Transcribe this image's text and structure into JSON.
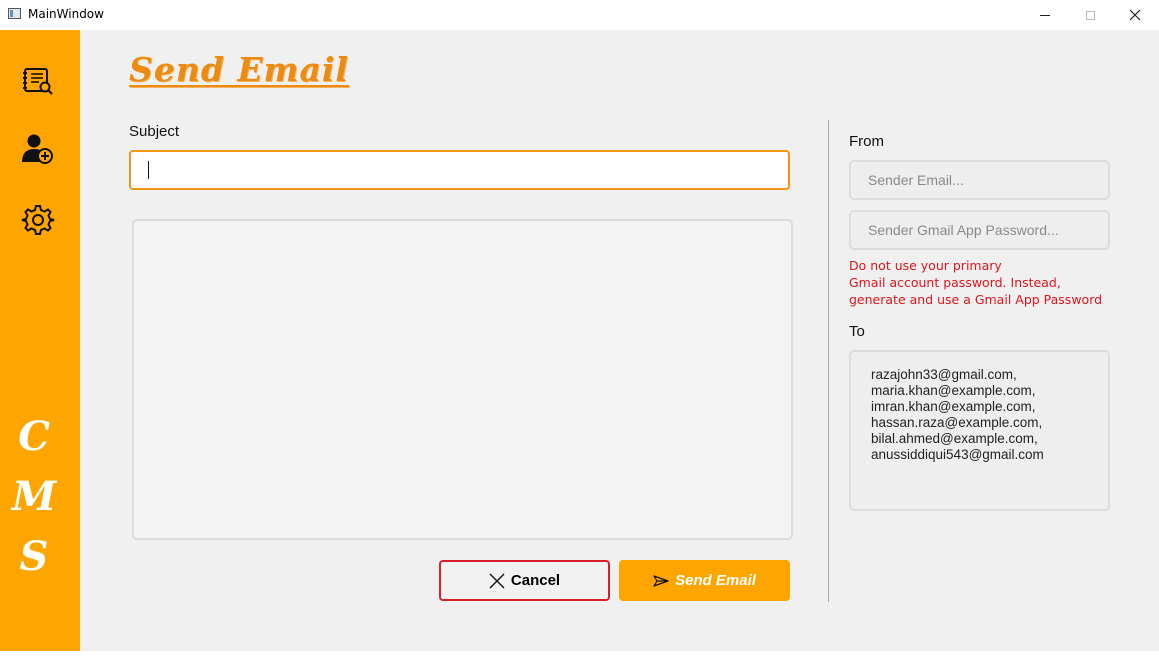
{
  "window": {
    "title": "MainWindow"
  },
  "sidebar": {
    "items": [
      {
        "icon": "address-book-icon"
      },
      {
        "icon": "add-user-icon"
      },
      {
        "icon": "gear-icon"
      }
    ],
    "brand_letters": [
      "C",
      "M",
      "S"
    ]
  },
  "page": {
    "title": "Send Email"
  },
  "form": {
    "subject_label": "Subject",
    "subject_value": "",
    "body_value": "",
    "cancel_label": "Cancel",
    "send_label": "Send Email"
  },
  "sender": {
    "from_label": "From",
    "email_placeholder": "Sender Email...",
    "password_placeholder": "Sender Gmail App Password...",
    "warning_lines": [
      "Do not use your primary",
      "Gmail account password. Instead,",
      "generate and use a Gmail App Password"
    ]
  },
  "recipients": {
    "to_label": "To",
    "list": [
      "razajohn33@gmail.com,",
      "maria.khan@example.com,",
      "imran.khan@example.com,",
      "hassan.raza@example.com,",
      "bilal.ahmed@example.com,",
      "anussiddiqui543@gmail.com"
    ]
  },
  "colors": {
    "accent": "#ffa500",
    "title": "#ec8a12",
    "warning": "#e0141c",
    "cancel_border": "#d9202a"
  }
}
